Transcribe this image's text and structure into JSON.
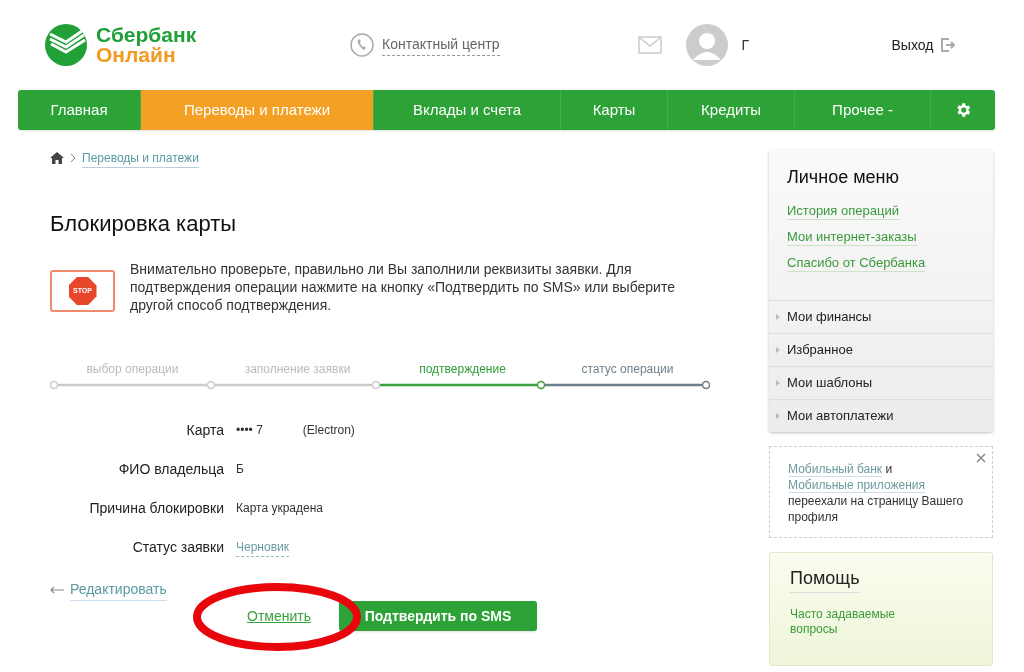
{
  "header": {
    "logo_line1": "Сбербанк",
    "logo_line2": "Онлайн",
    "contact": "Контактный центр",
    "user_name": "Г",
    "logout": "Выход"
  },
  "nav": [
    {
      "label": "Главная",
      "selected": false
    },
    {
      "label": "Переводы и платежи",
      "selected": true
    },
    {
      "label": "Вклады и счета",
      "selected": false
    },
    {
      "label": "Карты",
      "selected": false
    },
    {
      "label": "Кредиты",
      "selected": false
    },
    {
      "label": "Прочее -",
      "selected": false
    }
  ],
  "breadcrumb": [
    "Переводы и платежи"
  ],
  "title": "Блокировка карты",
  "warning": {
    "badge": "STOP",
    "text": "Внимательно проверьте, правильно ли Вы заполнили реквизиты заявки. Для подтверждения операции нажмите на кнопку «Подтвердить по SMS» или выберите другой способ подтверждения."
  },
  "steps": [
    {
      "label": "выбор операции",
      "kind": "done"
    },
    {
      "label": "заполнение заявки",
      "kind": "done"
    },
    {
      "label": "подтверждение",
      "kind": "current"
    },
    {
      "label": "статус операции",
      "kind": "pending"
    }
  ],
  "fields": [
    {
      "label": "Карта",
      "value": "•••• 7",
      "extra": "(Electron)",
      "kind": "text"
    },
    {
      "label": "ФИО владельца",
      "value": "Б",
      "kind": "text"
    },
    {
      "label": "Причина блокировки",
      "value": "Карта украдена",
      "kind": "text"
    },
    {
      "label": "Статус заявки",
      "value": "Черновик",
      "kind": "link"
    }
  ],
  "edit_link": "Редактировать",
  "cancel": "Отменить",
  "confirm": "Подтвердить по SMS",
  "personal_menu": {
    "title": "Личное меню",
    "links": [
      "История операций",
      "Мои интернет-заказы",
      "Спасибо от Сбербанка"
    ],
    "sections": [
      {
        "label": "Мои финансы",
        "expanded": false
      },
      {
        "label": "Избранное",
        "expanded": false
      },
      {
        "label": "Мои шаблоны",
        "expanded": false
      },
      {
        "label": "Мои автоплатежи",
        "expanded": false
      }
    ]
  },
  "notice": {
    "parts": [
      {
        "kind": "link",
        "text": "Мобильный банк"
      },
      {
        "kind": "text",
        "text": " и "
      },
      {
        "kind": "link",
        "text": "Мобильные приложения"
      },
      {
        "kind": "text",
        "text": " переехали на страницу Вашего профиля"
      }
    ]
  },
  "help": {
    "title": "Помощь",
    "links": [
      "Часто задаваемые вопросы"
    ]
  }
}
